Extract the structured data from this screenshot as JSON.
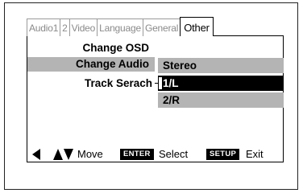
{
  "tabs": [
    {
      "label": "Audio1",
      "active": false
    },
    {
      "label": "2",
      "active": false
    },
    {
      "label": "Video",
      "active": false
    },
    {
      "label": "Language",
      "active": false
    },
    {
      "label": "General",
      "active": false
    },
    {
      "label": "Other",
      "active": true
    }
  ],
  "menu": {
    "items": [
      {
        "label": "Change OSD"
      },
      {
        "label": "Change Audio",
        "highlighted": true
      },
      {
        "label": "Track Serach"
      }
    ],
    "options": [
      {
        "label": "Stereo",
        "state": "highlighted"
      },
      {
        "label": "1/L",
        "state": "selected"
      },
      {
        "label": "2/R",
        "state": "highlighted"
      }
    ]
  },
  "footer": {
    "move_label": "Move",
    "enter_key": "ENTER",
    "select_label": "Select",
    "setup_key": "SETUP",
    "exit_label": "Exit"
  },
  "icons": {
    "left_arrow": "triangle-left-icon",
    "up_arrow": "triangle-up-icon",
    "down_arrow": "triangle-down-icon"
  },
  "colors": {
    "highlight": "#b4b4b4",
    "selected_bg": "#000000",
    "selected_text": "#ffffff",
    "inactive_tab_text": "#8a8a8a"
  }
}
